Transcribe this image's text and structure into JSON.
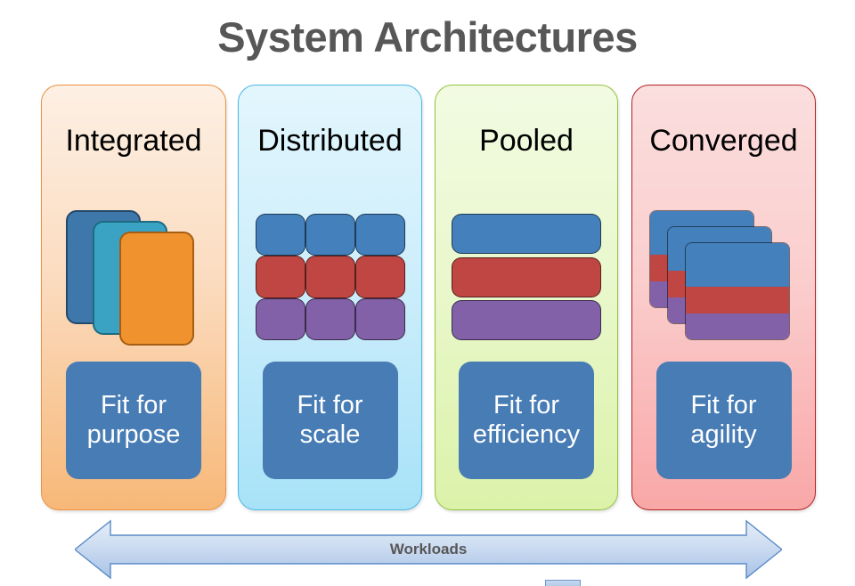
{
  "slide": {
    "title": "System Architectures",
    "title_color": "#575757",
    "background": "#ffffff"
  },
  "panels": [
    {
      "id": "integrated",
      "title": "Integrated",
      "theme": "orange",
      "fill_top": "#fdf0e4",
      "fill_bottom": "#f7b878",
      "border": "#ed9042",
      "graphic": "offset-card-stack",
      "graphic_colors": [
        "#3e78ab",
        "#3aa3c4",
        "#f0932e"
      ],
      "fit_label": "Fit for\npurpose",
      "fit_line1": "Fit for",
      "fit_line2": "purpose",
      "fit_box_color": "#477cb5"
    },
    {
      "id": "distributed",
      "title": "Distributed",
      "theme": "blue",
      "fill_top": "#e3f6fd",
      "fill_bottom": "#a8e2f8",
      "border": "#49b9e3",
      "graphic": "three-by-three-grid",
      "graphic_colors": [
        "#4480bb",
        "#bf4642",
        "#8261a8"
      ],
      "fit_label": "Fit for\nscale",
      "fit_line1": "Fit for",
      "fit_line2": "scale",
      "fit_box_color": "#477cb5"
    },
    {
      "id": "pooled",
      "title": "Pooled",
      "theme": "green",
      "fill_top": "#f2fbe2",
      "fill_bottom": "#dcf2a9",
      "border": "#93c440",
      "graphic": "three-horizontal-bars",
      "graphic_colors": [
        "#4480bb",
        "#bf4642",
        "#8261a8"
      ],
      "fit_label": "Fit for\nefficiency",
      "fit_line1": "Fit for",
      "fit_line2": "efficiency",
      "fit_box_color": "#477cb5"
    },
    {
      "id": "converged",
      "title": "Converged",
      "theme": "red",
      "fill_top": "#fbdede",
      "fill_bottom": "#f9a7a7",
      "border": "#b22222",
      "graphic": "offset-banded-card-stack",
      "graphic_colors": [
        "#4480bb",
        "#bf4642",
        "#8261a8"
      ],
      "fit_label": "Fit for\nagility",
      "fit_line1": "Fit for",
      "fit_line2": "agility",
      "fit_box_color": "#477cb5"
    }
  ],
  "arrow": {
    "label": "Workloads",
    "label_color": "#575757",
    "fill_light": "#dce6f5",
    "fill_mid": "#c3d6ef",
    "fill_dark": "#aac4e8",
    "stroke": "#5b8bc8",
    "direction": "double-headed-horizontal"
  }
}
